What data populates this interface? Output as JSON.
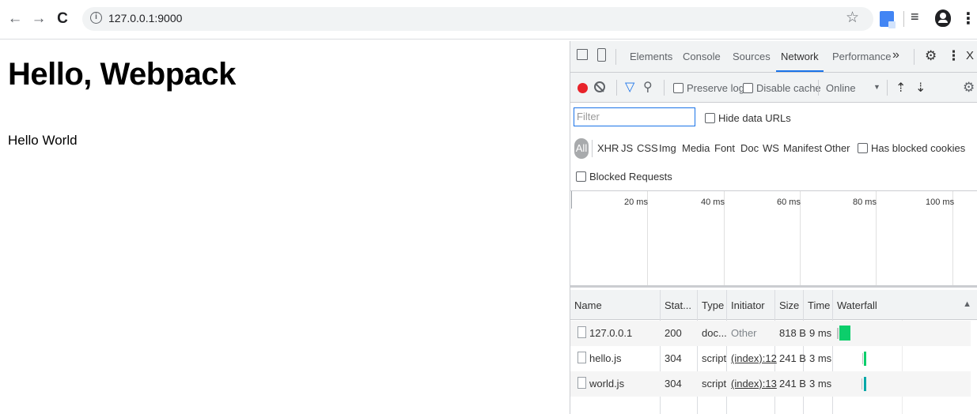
{
  "browser": {
    "url": "127.0.0.1:9000",
    "back_icon": "←",
    "forward_icon": "→",
    "reload_icon": "C",
    "info_icon": "i",
    "star_icon": "☆",
    "queue_icon": "≡",
    "menu_icon": "⋮"
  },
  "page": {
    "heading": "Hello, Webpack",
    "paragraph": "Hello World"
  },
  "devtools": {
    "tabs": [
      "Elements",
      "Console",
      "Sources",
      "Network",
      "Performance"
    ],
    "active_tab": "Network",
    "more_tabs_icon": "»",
    "gear_icon": "⚙",
    "kebab_icon": "⋮",
    "close_icon": "X",
    "toolbar": {
      "preserve_log": "Preserve log",
      "disable_cache": "Disable cache",
      "throttle": "Online",
      "throttle_caret": "▼",
      "upload_icon": "⇡",
      "download_icon": "⇣"
    },
    "filter": {
      "placeholder": "Filter",
      "hide_data_urls": "Hide data URLs",
      "types": [
        "All",
        "XHR",
        "JS",
        "CSS",
        "Img",
        "Media",
        "Font",
        "Doc",
        "WS",
        "Manifest",
        "Other"
      ],
      "active_type": "All",
      "has_blocked_cookies": "Has blocked cookies",
      "blocked_requests": "Blocked Requests"
    },
    "overview_ticks": [
      "20 ms",
      "40 ms",
      "60 ms",
      "80 ms",
      "100 ms"
    ],
    "table": {
      "columns": [
        "Name",
        "Stat...",
        "Type",
        "Initiator",
        "Size",
        "Time",
        "Waterfall"
      ],
      "sort_icon": "▲",
      "rows": [
        {
          "name": "127.0.0.1",
          "status": "200",
          "type": "doc...",
          "initiator": "Other",
          "size": "818 B",
          "time": "9 ms"
        },
        {
          "name": "hello.js",
          "status": "304",
          "type": "script",
          "initiator": "(index):12",
          "size": "241 B",
          "time": "3 ms"
        },
        {
          "name": "world.js",
          "status": "304",
          "type": "script",
          "initiator": "(index):13",
          "size": "241 B",
          "time": "3 ms"
        }
      ]
    },
    "colors": {
      "accent": "#1a73e8",
      "record": "#e8232a",
      "waterfall_green": "#0cce6b",
      "waterfall_teal": "#00a8a8"
    }
  }
}
